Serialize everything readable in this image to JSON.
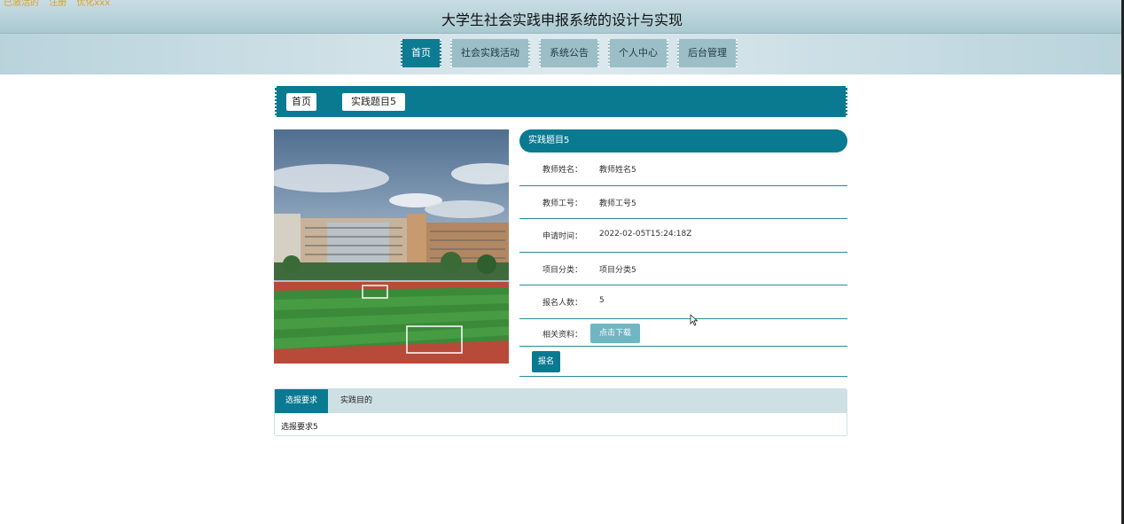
{
  "header": {
    "top_links": [
      "已激活的",
      "注册",
      "优化xxx"
    ],
    "title": "大学生社会实践申报系统的设计与实现"
  },
  "nav": {
    "items": [
      "首页",
      "社会实践活动",
      "系统公告",
      "个人中心",
      "后台管理"
    ]
  },
  "breadcrumb": {
    "home": "首页",
    "current": "实践题目5"
  },
  "detail": {
    "title": "实践题目5",
    "fields": [
      {
        "label": "教师姓名：",
        "value": "教师姓名5"
      },
      {
        "label": "教师工号：",
        "value": "教师工号5"
      },
      {
        "label": "申请时间：",
        "value": "2022-02-05T15:24:18Z"
      },
      {
        "label": "项目分类：",
        "value": "项目分类5"
      },
      {
        "label": "报名人数：",
        "value": "5"
      }
    ],
    "file_label": "相关资料：",
    "download_label": "点击下载",
    "signup_label": "报名"
  },
  "tabs": {
    "items": [
      "选报要求",
      "实践目的"
    ],
    "content": "选报要求5"
  },
  "colors": {
    "primary": "#0a7a91",
    "header_bg": "#b9d3dc",
    "download_btn": "#6fb6c2"
  }
}
